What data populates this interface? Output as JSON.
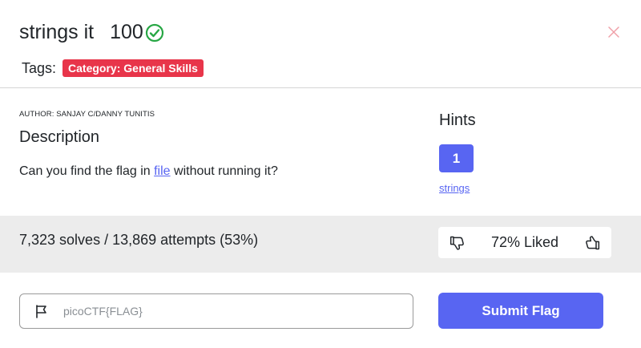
{
  "challenge": {
    "title": "strings it",
    "points": "100",
    "solved_icon": "check-circle-icon",
    "close_icon": "close-icon"
  },
  "tags": {
    "label": "Tags:",
    "items": [
      "Category: General Skills"
    ]
  },
  "description": {
    "author": "AUTHOR: SANJAY C/DANNY TUNITIS",
    "heading": "Description",
    "text_before": "Can you find the flag in ",
    "link_text": "file",
    "text_after": " without running it?"
  },
  "hints": {
    "heading": "Hints",
    "button_label": "1",
    "link_text": "strings"
  },
  "stats": {
    "text": "7,323 solves / 13,869 attempts (53%)",
    "liked_text": "72% Liked",
    "dislike_icon": "thumbs-down-icon",
    "like_icon": "thumbs-up-icon"
  },
  "flag_form": {
    "placeholder": "picoCTF{FLAG}",
    "value": "",
    "submit_label": "Submit Flag"
  },
  "colors": {
    "accent": "#5865f2",
    "tag": "#e8354a",
    "success": "#28a745",
    "band": "#ececec"
  }
}
